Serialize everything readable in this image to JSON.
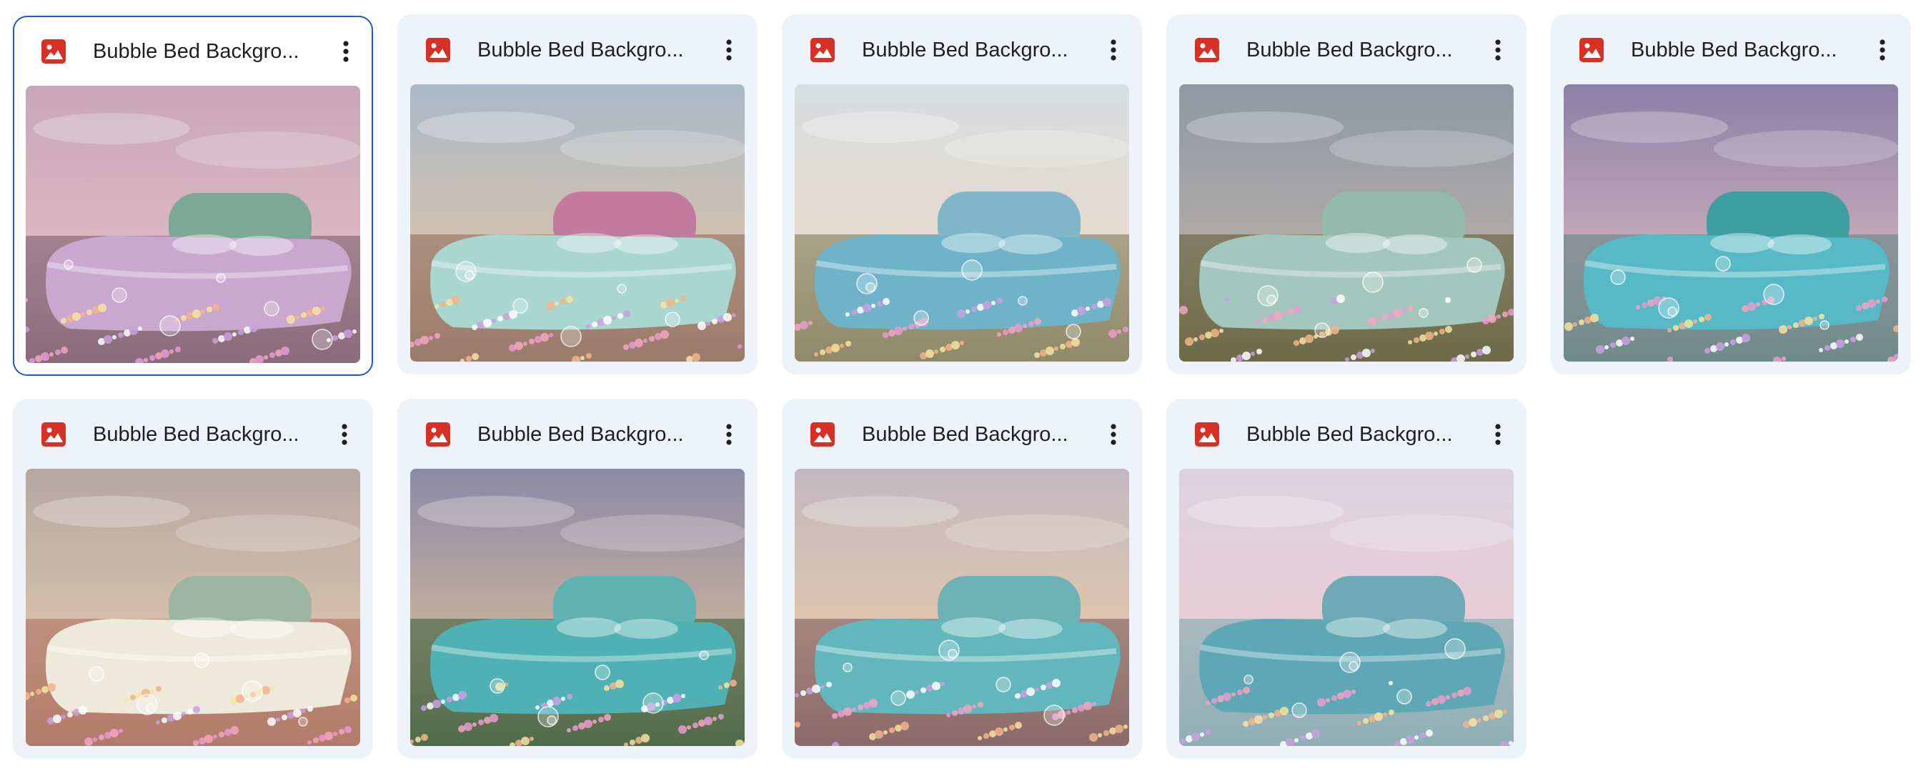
{
  "files": [
    {
      "title": "Bubble Bed Backgro...",
      "type_icon": "image-icon",
      "selected": true,
      "sky": [
        "#c9a7b8",
        "#e8c3c8"
      ],
      "headboard": "#7ca896",
      "bed": "#c9a7cf",
      "ground": "#8a6b7a"
    },
    {
      "title": "Bubble Bed Backgro...",
      "type_icon": "image-icon",
      "selected": false,
      "sky": [
        "#a9b9c9",
        "#f1c79a"
      ],
      "headboard": "#c27a9e",
      "bed": "#a9d6cf",
      "ground": "#9a7a6a"
    },
    {
      "title": "Bubble Bed Backgro...",
      "type_icon": "image-icon",
      "selected": false,
      "sky": [
        "#d7dde0",
        "#f1d8c0"
      ],
      "headboard": "#7fb6c8",
      "bed": "#6fb3c9",
      "ground": "#8f8a6a"
    },
    {
      "title": "Bubble Bed Backgro...",
      "type_icon": "image-icon",
      "selected": false,
      "sky": [
        "#8e98a4",
        "#c9b8a8"
      ],
      "headboard": "#96b9ad",
      "bed": "#a3c7bd",
      "ground": "#6d6a48"
    },
    {
      "title": "Bubble Bed Backgro...",
      "type_icon": "image-icon",
      "selected": false,
      "sky": [
        "#8a7fa6",
        "#f0c6c8"
      ],
      "headboard": "#3e9ea0",
      "bed": "#58b9c6",
      "ground": "#6f8a8a"
    },
    {
      "title": "Bubble Bed Backgro...",
      "type_icon": "image-icon",
      "selected": false,
      "sky": [
        "#b6a7a3",
        "#efd2ae"
      ],
      "headboard": "#9cb5a0",
      "bed": "#eeeadb",
      "ground": "#b27a6a"
    },
    {
      "title": "Bubble Bed Backgro...",
      "type_icon": "image-icon",
      "selected": false,
      "sky": [
        "#8a8aa6",
        "#f1c79a"
      ],
      "headboard": "#5fb2b2",
      "bed": "#4fb1b3",
      "ground": "#506b4a"
    },
    {
      "title": "Bubble Bed Backgro...",
      "type_icon": "image-icon",
      "selected": false,
      "sky": [
        "#c3b8c1",
        "#f5cf9e"
      ],
      "headboard": "#6eb2b5",
      "bed": "#62b7bc",
      "ground": "#8a6a6a"
    },
    {
      "title": "Bubble Bed Backgro...",
      "type_icon": "image-icon",
      "selected": false,
      "sky": [
        "#dcd3dd",
        "#f3c6cf"
      ],
      "headboard": "#6fa9b6",
      "bed": "#5ea7b5",
      "ground": "#8fb0b6"
    }
  ]
}
